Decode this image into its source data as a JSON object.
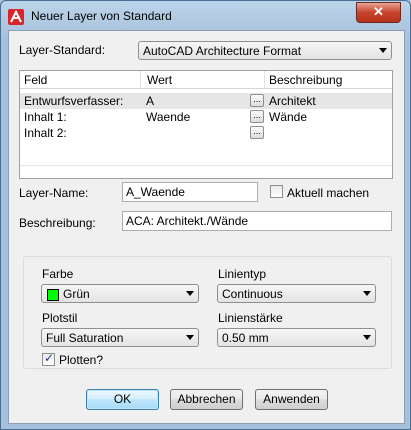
{
  "window": {
    "title": "Neuer Layer von Standard",
    "close_glyph": "✕"
  },
  "layer_standard": {
    "label": "Layer-Standard:",
    "value": "AutoCAD Architecture Format"
  },
  "grid": {
    "headers": [
      "Feld",
      "Wert",
      "Beschreibung"
    ],
    "rows": [
      {
        "feld": "Entwurfsverfasser:",
        "wert": "A",
        "beschreibung": "Architekt"
      },
      {
        "feld": "Inhalt 1:",
        "wert": "Waende",
        "beschreibung": "Wände"
      },
      {
        "feld": "Inhalt 2:",
        "wert": "",
        "beschreibung": ""
      }
    ],
    "ellipsis": "..."
  },
  "layer_name": {
    "label": "Layer-Name:",
    "value": "A_Waende"
  },
  "aktuell": {
    "label": "Aktuell machen",
    "checked": false
  },
  "beschreibung": {
    "label": "Beschreibung:",
    "value": "ACA:  Architekt./Wände"
  },
  "farbe": {
    "label": "Farbe",
    "value": "Grün",
    "swatch_color": "#00ff00"
  },
  "linientyp": {
    "label": "Linientyp",
    "value": "Continuous"
  },
  "plotstil": {
    "label": "Plotstil",
    "value": "Full Saturation"
  },
  "linienstaerke": {
    "label": "Linienstärke",
    "value": "0.50 mm"
  },
  "plotten": {
    "label": "Plotten?",
    "checked": true
  },
  "buttons": {
    "ok": "OK",
    "cancel": "Abbrechen",
    "apply": "Anwenden"
  }
}
